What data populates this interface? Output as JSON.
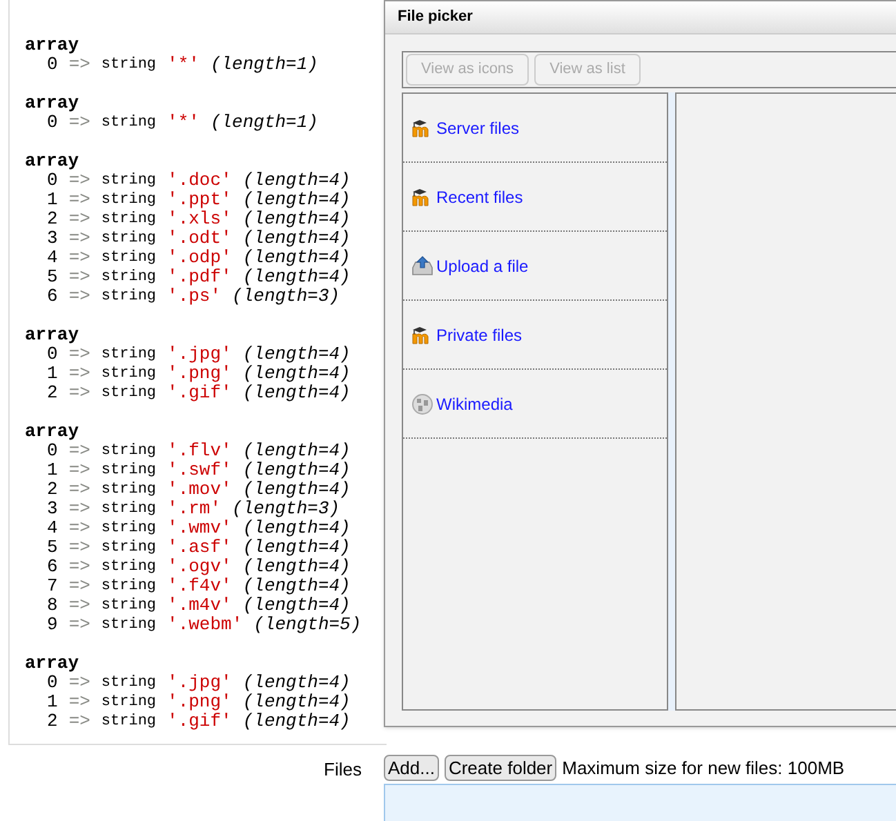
{
  "dump": [
    {
      "label": "array",
      "items": [
        {
          "index": "0",
          "arrow": "=>",
          "type": "string",
          "value": "'*'",
          "length": "(length=1)"
        }
      ]
    },
    {
      "label": "array",
      "items": [
        {
          "index": "0",
          "arrow": "=>",
          "type": "string",
          "value": "'*'",
          "length": "(length=1)"
        }
      ]
    },
    {
      "label": "array",
      "items": [
        {
          "index": "0",
          "arrow": "=>",
          "type": "string",
          "value": "'.doc'",
          "length": "(length=4)"
        },
        {
          "index": "1",
          "arrow": "=>",
          "type": "string",
          "value": "'.ppt'",
          "length": "(length=4)"
        },
        {
          "index": "2",
          "arrow": "=>",
          "type": "string",
          "value": "'.xls'",
          "length": "(length=4)"
        },
        {
          "index": "3",
          "arrow": "=>",
          "type": "string",
          "value": "'.odt'",
          "length": "(length=4)"
        },
        {
          "index": "4",
          "arrow": "=>",
          "type": "string",
          "value": "'.odp'",
          "length": "(length=4)"
        },
        {
          "index": "5",
          "arrow": "=>",
          "type": "string",
          "value": "'.pdf'",
          "length": "(length=4)"
        },
        {
          "index": "6",
          "arrow": "=>",
          "type": "string",
          "value": "'.ps'",
          "length": "(length=3)"
        }
      ]
    },
    {
      "label": "array",
      "items": [
        {
          "index": "0",
          "arrow": "=>",
          "type": "string",
          "value": "'.jpg'",
          "length": "(length=4)"
        },
        {
          "index": "1",
          "arrow": "=>",
          "type": "string",
          "value": "'.png'",
          "length": "(length=4)"
        },
        {
          "index": "2",
          "arrow": "=>",
          "type": "string",
          "value": "'.gif'",
          "length": "(length=4)"
        }
      ]
    },
    {
      "label": "array",
      "items": [
        {
          "index": "0",
          "arrow": "=>",
          "type": "string",
          "value": "'.flv'",
          "length": "(length=4)"
        },
        {
          "index": "1",
          "arrow": "=>",
          "type": "string",
          "value": "'.swf'",
          "length": "(length=4)"
        },
        {
          "index": "2",
          "arrow": "=>",
          "type": "string",
          "value": "'.mov'",
          "length": "(length=4)"
        },
        {
          "index": "3",
          "arrow": "=>",
          "type": "string",
          "value": "'.rm'",
          "length": "(length=3)"
        },
        {
          "index": "4",
          "arrow": "=>",
          "type": "string",
          "value": "'.wmv'",
          "length": "(length=4)"
        },
        {
          "index": "5",
          "arrow": "=>",
          "type": "string",
          "value": "'.asf'",
          "length": "(length=4)"
        },
        {
          "index": "6",
          "arrow": "=>",
          "type": "string",
          "value": "'.ogv'",
          "length": "(length=4)"
        },
        {
          "index": "7",
          "arrow": "=>",
          "type": "string",
          "value": "'.f4v'",
          "length": "(length=4)"
        },
        {
          "index": "8",
          "arrow": "=>",
          "type": "string",
          "value": "'.m4v'",
          "length": "(length=4)"
        },
        {
          "index": "9",
          "arrow": "=>",
          "type": "string",
          "value": "'.webm'",
          "length": "(length=5)"
        }
      ]
    },
    {
      "label": "array",
      "items": [
        {
          "index": "0",
          "arrow": "=>",
          "type": "string",
          "value": "'.jpg'",
          "length": "(length=4)"
        },
        {
          "index": "1",
          "arrow": "=>",
          "type": "string",
          "value": "'.png'",
          "length": "(length=4)"
        },
        {
          "index": "2",
          "arrow": "=>",
          "type": "string",
          "value": "'.gif'",
          "length": "(length=4)"
        }
      ]
    }
  ],
  "file_picker": {
    "title": "File picker",
    "view_buttons": [
      {
        "label": "View as icons",
        "disabled": true
      },
      {
        "label": "View as list",
        "disabled": true
      }
    ],
    "repositories": [
      {
        "label": "Server files",
        "kind": "moodle"
      },
      {
        "label": "Recent files",
        "kind": "moodle"
      },
      {
        "label": "Upload a file",
        "kind": "upload"
      },
      {
        "label": "Private files",
        "kind": "moodle"
      },
      {
        "label": "Wikimedia",
        "kind": "wiki"
      }
    ]
  },
  "files": {
    "label": "Files",
    "buttons": [
      "Add...",
      "Create folder"
    ],
    "note": "Maximum size for new files: 100MB"
  }
}
